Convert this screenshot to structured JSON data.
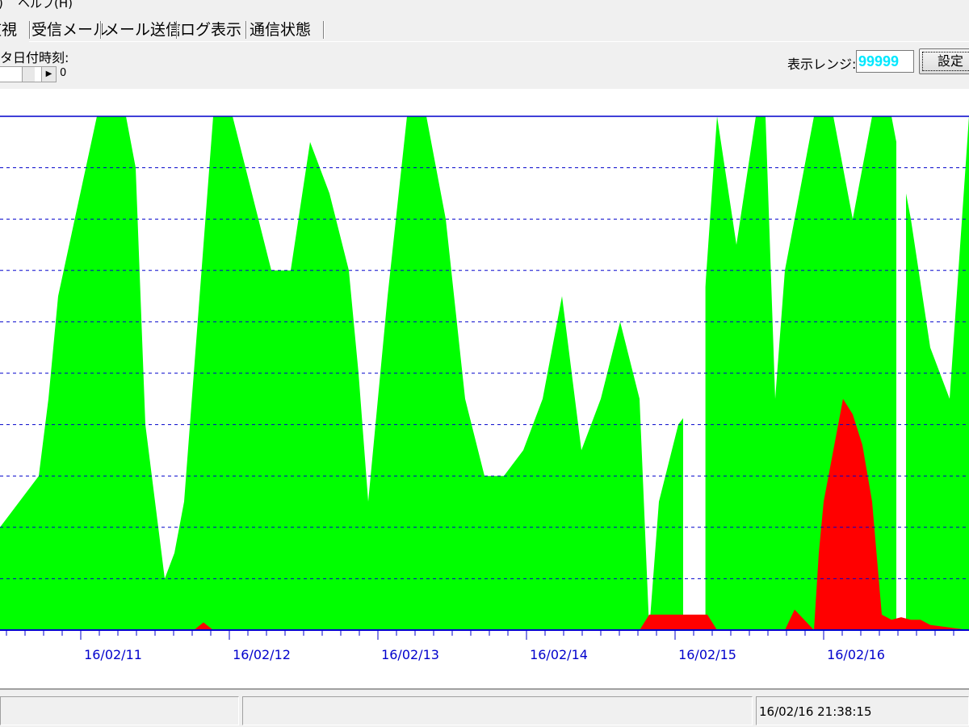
{
  "menu": {
    "partial_item": ")",
    "help": "ヘルプ(H)"
  },
  "tabs": [
    {
      "label": "監視",
      "active": true
    },
    {
      "label": "受信メール",
      "active": false
    },
    {
      "label": "メール送信",
      "active": false
    },
    {
      "label": "ログ表示",
      "active": false
    },
    {
      "label": "通信状態",
      "active": false
    }
  ],
  "toolbar": {
    "date_time_label": "タ日付時刻:",
    "scroll_value": "0",
    "range_label": "表示レンジ:",
    "range_value": "99999",
    "set_button": "設定"
  },
  "status": {
    "timestamp": "16/02/16 21:38:15"
  },
  "colors": {
    "series_green": "#00ff00",
    "series_red": "#ff0000",
    "grid": "#0000cc",
    "axis_labels": "#0000cc",
    "range_value": "#00e8ff"
  },
  "chart_data": {
    "type": "area",
    "grid": true,
    "y_range": [
      0,
      99999
    ],
    "x_tick_labels": [
      "16/02/11",
      "16/02/12",
      "16/02/13",
      "16/02/14",
      "16/02/15",
      "16/02/16"
    ],
    "series": [
      {
        "color": "#00ff00",
        "x": [
          0.0,
          0.02,
          0.04,
          0.05,
          0.06,
          0.1,
          0.13,
          0.14,
          0.15,
          0.17,
          0.18,
          0.19,
          0.2,
          0.21,
          0.22,
          0.24,
          0.26,
          0.28,
          0.3,
          0.32,
          0.34,
          0.36,
          0.37,
          0.38,
          0.4,
          0.42,
          0.44,
          0.46,
          0.48,
          0.5,
          0.52,
          0.54,
          0.56,
          0.58,
          0.6,
          0.62,
          0.64,
          0.66,
          0.67,
          0.68,
          0.7,
          0.72,
          0.74,
          0.76,
          0.78,
          0.79,
          0.8,
          0.81,
          0.82,
          0.84,
          0.86,
          0.88,
          0.9,
          0.92,
          0.94,
          0.96,
          0.98,
          1.0
        ],
        "values": [
          20000,
          25000,
          30000,
          45000,
          65000,
          100000,
          100000,
          90000,
          40000,
          10000,
          15000,
          25000,
          50000,
          75000,
          100000,
          100000,
          85000,
          70000,
          70000,
          95000,
          85000,
          70000,
          50000,
          25000,
          65000,
          100000,
          100000,
          80000,
          45000,
          30000,
          30000,
          35000,
          45000,
          65000,
          35000,
          45000,
          60000,
          45000,
          0,
          25000,
          40000,
          45000,
          100000,
          75000,
          100000,
          100000,
          45000,
          70000,
          80000,
          100000,
          100000,
          80000,
          100000,
          100000,
          80000,
          55000,
          45000,
          100000
        ],
        "gaps": [
          [
            0.705,
            0.728
          ],
          [
            0.925,
            0.935
          ]
        ]
      },
      {
        "color": "#ff0000",
        "x": [
          0.0,
          0.2,
          0.21,
          0.22,
          0.66,
          0.67,
          0.73,
          0.74,
          0.81,
          0.82,
          0.84,
          0.845,
          0.85,
          0.86,
          0.87,
          0.88,
          0.89,
          0.9,
          0.91,
          0.92,
          0.93,
          0.94,
          0.95,
          0.96,
          1.0
        ],
        "values": [
          0,
          0,
          1500,
          0,
          0,
          3000,
          3000,
          0,
          0,
          4000,
          0,
          15000,
          25000,
          35000,
          45000,
          42000,
          36000,
          25000,
          3000,
          2000,
          2500,
          2000,
          2000,
          1000,
          0
        ]
      }
    ]
  }
}
